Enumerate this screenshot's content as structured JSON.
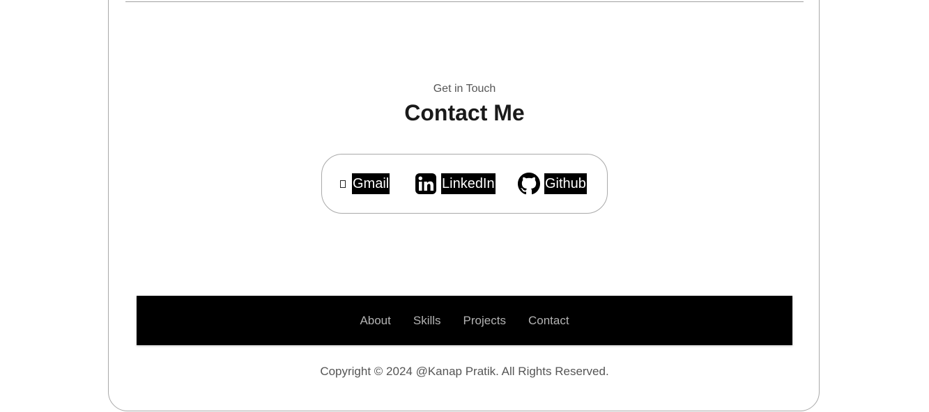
{
  "contact": {
    "eyebrow": "Get in Touch",
    "title": "Contact Me",
    "links": [
      {
        "label": "Gmail",
        "icon": "mail-icon"
      },
      {
        "label": "LinkedIn",
        "icon": "linkedin-icon"
      },
      {
        "label": "Github",
        "icon": "github-icon"
      }
    ]
  },
  "footer": {
    "nav": [
      "About",
      "Skills",
      "Projects",
      "Contact"
    ],
    "copyright": "Copyright © 2024 @Kanap Pratik. All Rights Reserved."
  },
  "colors": {
    "background": "#ffffff",
    "footer_bar": "#000000",
    "footer_link": "#b4b4b4",
    "label_highlight": "#000000"
  }
}
